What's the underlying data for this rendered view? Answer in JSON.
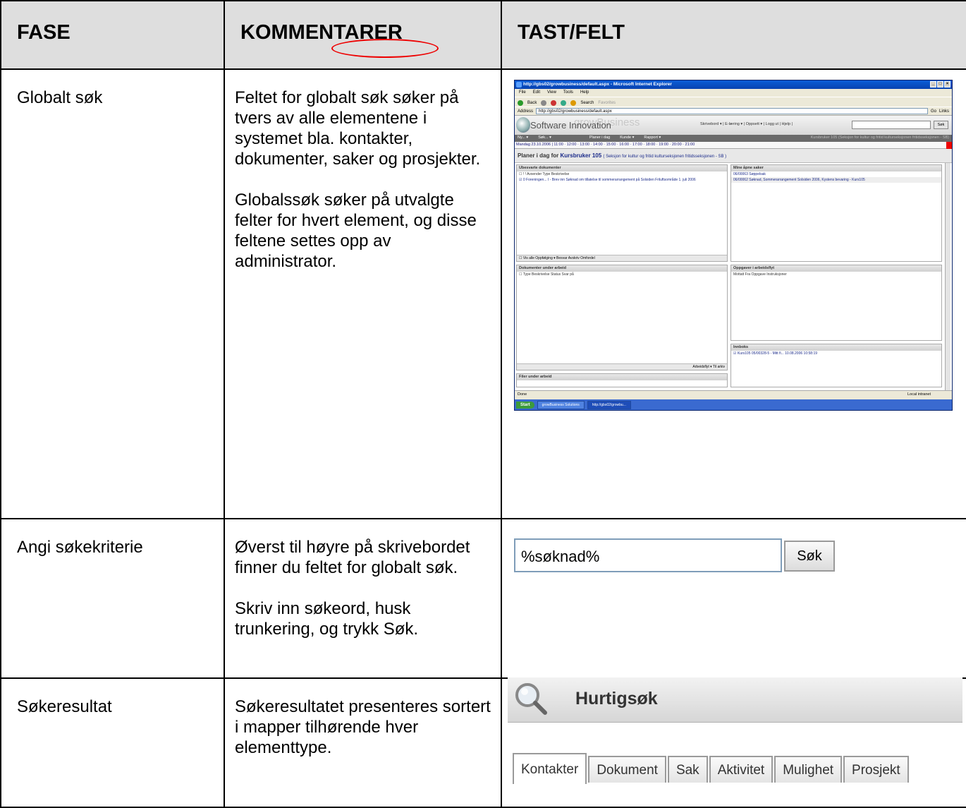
{
  "headers": {
    "fase": "FASE",
    "kommentarer": "KOMMENTARER",
    "tast": "TAST/FELT"
  },
  "rows": [
    {
      "fase": "Globalt søk",
      "kommentarer": [
        "Feltet for globalt søk søker på tvers av alle elementene i systemet bla. kontakter, dokumenter, saker og prosjekter.",
        "Globalssøk søker på utvalgte felter for hvert element, og disse feltene settes opp av administrator."
      ]
    },
    {
      "fase": "Angi søkekriterie",
      "kommentarer": [
        "Øverst til høyre på skrivebordet finner du feltet for globalt søk.",
        "Skriv inn søkeord, husk trunkering, og trykk Søk."
      ]
    },
    {
      "fase": "Søkeresultat",
      "kommentarer": [
        "Søkeresultatet presenteres sortert i mapper tilhørende hver elementtype."
      ]
    }
  ],
  "ie": {
    "title": "http://gbs02/growbusiness/default.aspx - Microsoft Internet Explorer",
    "menu": [
      "File",
      "Edit",
      "View",
      "Tools",
      "Help"
    ],
    "toolbar": [
      "Back",
      "Search",
      "Favorites"
    ],
    "address_label": "Address",
    "address": "http://gbs02/growbusiness/default.aspx",
    "go": "Go",
    "links": "Links",
    "brand": "Software Innovation",
    "brand_shadow": "growBusiness",
    "nav": "Skrivebord ▾ | E-læring ▾ | Oppsett ▾ | Logg ut | Hjelp |",
    "search_btn": "Søk",
    "menu2": [
      "Ny... ▾",
      "Søk... ▾",
      "Planer i dag",
      "Kunde ▾",
      "Rapport ▾"
    ],
    "menu2_right": "Kursbruker 105 (Seksjon for kultur og fritid kulturseksjonen fritidsseksjonen - SB)",
    "timeline": "Mandag 23.10.2006 | 11:00 · 12:00 · 13:00 · 14:00 · 15:00 · 16:00 · 17:00 · 18:00 · 19:00 · 20:00 · 21:00",
    "heading_prefix": "Planer i dag for",
    "heading_user": "Kursbruker 105",
    "heading_org": "( Seksjon for kultur og fritid kulturseksjonen fritidsseksjonen - SB )",
    "pane1_title": "Ubesvarte dokumenter",
    "pane1_cols": "☐ ! !   Avsender   Type   Beskrivelse",
    "pane1_row": "☑ 0 Foreningen... I - Brev inn Søknad om tillatelse til sommerarrangement på Solsiden Friluftsområde 1. juli 2006",
    "pane1_foot": "☐ Vis alle          Oppfølging ▾  Besvar  Avskriv  Omfordel",
    "pane2_title": "Mine åpne saker",
    "pane2_rows": [
      "06/00063 Søppelsak",
      "06/00062 Søknad, Sommerarrangement Solsiden 2006, Kystens bevaring - Kurs105"
    ],
    "pane3_title": "Dokumenter under arbeid",
    "pane3_cols": "☐ Type  Beskrivelse Status  Svar på",
    "pane3_foot": "Arbeidsflyt ▾  Til arkiv",
    "pane4_title": "Oppgaver i arbeidsflyt",
    "pane4_cols": "Mottatt  Fra   Oppgave   Instruksjoner",
    "pane5_title": "Innboks",
    "pane5_row": "☑ Kurs105      05/00328-5 - Mitt fi...      10.08.2006 10:58:19",
    "pane6_title": "Filer under arbeid",
    "status": "Done",
    "status_right": "Local intranet",
    "start": "Start",
    "tasks": [
      "growBusiness Solutions",
      "http://gbs02/growbu..."
    ]
  },
  "criteria": {
    "value": "%søknad%",
    "button": "Søk"
  },
  "result": {
    "title": "Hurtigsøk",
    "tabs": [
      "Kontakter",
      "Dokument",
      "Sak",
      "Aktivitet",
      "Mulighet",
      "Prosjekt"
    ]
  }
}
